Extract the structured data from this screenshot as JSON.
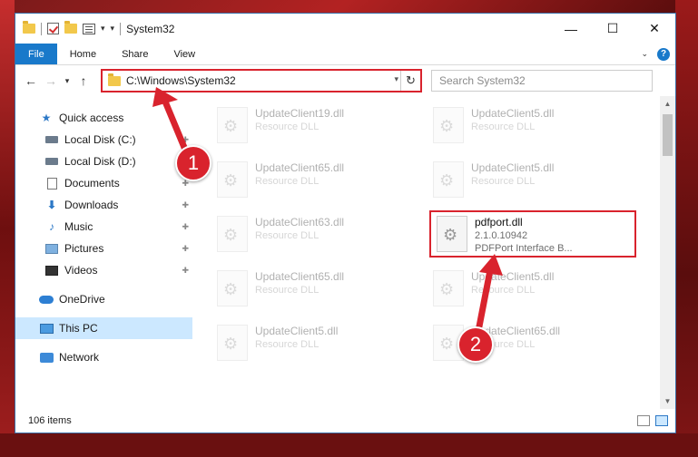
{
  "window": {
    "title": "System32"
  },
  "ribbon": {
    "tabs": [
      "File",
      "Home",
      "Share",
      "View"
    ]
  },
  "address": {
    "path": "C:\\Windows\\System32"
  },
  "search": {
    "placeholder": "Search System32"
  },
  "sidebar": {
    "items": [
      {
        "label": "Quick access",
        "icon": "star-icon"
      },
      {
        "label": "Local Disk (C:)",
        "icon": "drive-icon"
      },
      {
        "label": "Local Disk (D:)",
        "icon": "drive-icon"
      },
      {
        "label": "Documents",
        "icon": "document-icon"
      },
      {
        "label": "Downloads",
        "icon": "download-icon"
      },
      {
        "label": "Music",
        "icon": "music-icon"
      },
      {
        "label": "Pictures",
        "icon": "pictures-icon"
      },
      {
        "label": "Videos",
        "icon": "videos-icon"
      },
      {
        "label": "OneDrive",
        "icon": "cloud-icon"
      },
      {
        "label": "This PC",
        "icon": "computer-icon"
      },
      {
        "label": "Network",
        "icon": "network-icon"
      }
    ]
  },
  "files": [
    {
      "name": "UpdateClient19.dll",
      "sub": "Resource DLL"
    },
    {
      "name": "UpdateClient5.dll",
      "sub": "Resource DLL"
    },
    {
      "name": "UpdateClient65.dll",
      "sub": "Resource DLL"
    },
    {
      "name": "UpdateClient5.dll",
      "sub": "Resource DLL"
    },
    {
      "name": "UpdateClient63.dll",
      "sub": "Resource DLL"
    },
    {
      "name": "pdfport.dll",
      "version": "2.1.0.10942",
      "desc": "PDFPort Interface B..."
    },
    {
      "name": "UpdateClient65.dll",
      "sub": "Resource DLL"
    },
    {
      "name": "UpdateClient5.dll",
      "sub": "Resource DLL"
    },
    {
      "name": "UpdateClient5.dll",
      "sub": "Resource DLL"
    },
    {
      "name": "UpdateClient65.dll",
      "sub": "Resource DLL"
    }
  ],
  "status": {
    "items_count": "106 items"
  },
  "annotations": {
    "step1": "1",
    "step2": "2"
  },
  "colors": {
    "highlight": "#d9232d",
    "accent": "#1979ca"
  }
}
